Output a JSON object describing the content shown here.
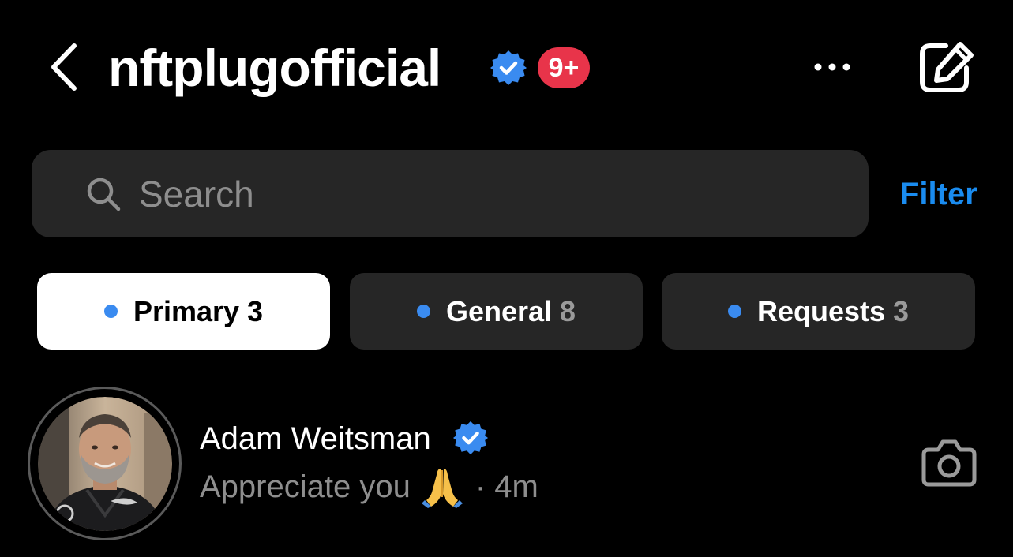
{
  "header": {
    "back_icon": "chevron-left-icon",
    "title": "nftplugofficial",
    "verified": true,
    "notification_badge": "9+",
    "more_icon": "more-horizontal-icon",
    "compose_icon": "compose-icon"
  },
  "search": {
    "placeholder": "Search",
    "value": "",
    "icon": "search-icon"
  },
  "filter_label": "Filter",
  "tabs": [
    {
      "label": "Primary",
      "count": "3",
      "active": true
    },
    {
      "label": "General",
      "count": "8",
      "active": false
    },
    {
      "label": "Requests",
      "count": "3",
      "active": false
    }
  ],
  "conversations": [
    {
      "name": "Adam Weitsman",
      "verified": true,
      "preview": "Appreciate you",
      "preview_emoji": "folded-hands",
      "time": "· 4m",
      "action_icon": "camera-icon"
    }
  ],
  "colors": {
    "background": "#000000",
    "accent": "#1a8cf0",
    "badge": "#e8344a",
    "verified": "#3a8bf0",
    "surface": "#262626",
    "muted_text": "#8e8e8e"
  }
}
